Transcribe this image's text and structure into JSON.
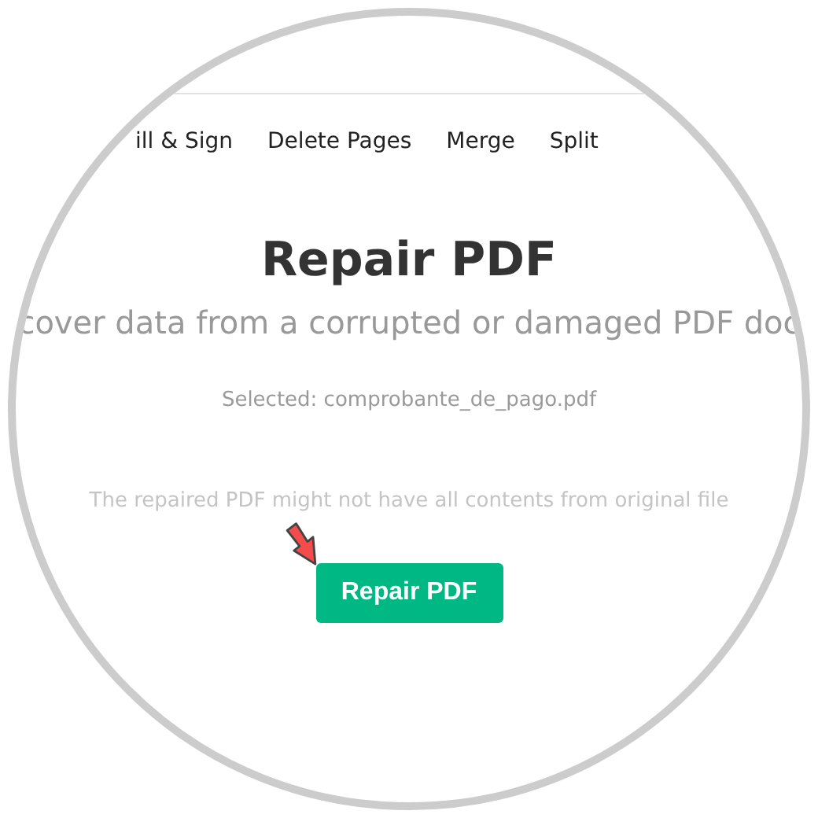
{
  "nav": [
    {
      "label": "ill & Sign"
    },
    {
      "label": "Delete Pages"
    },
    {
      "label": "Merge"
    },
    {
      "label": "Split"
    }
  ],
  "title": "Repair PDF",
  "subtitle": "cover data from a corrupted or damaged PDF doc",
  "selected_file": "Selected: comprobante_de_pago.pdf",
  "note": "The repaired PDF might not have all contents from original file",
  "button": "Repair PDF"
}
